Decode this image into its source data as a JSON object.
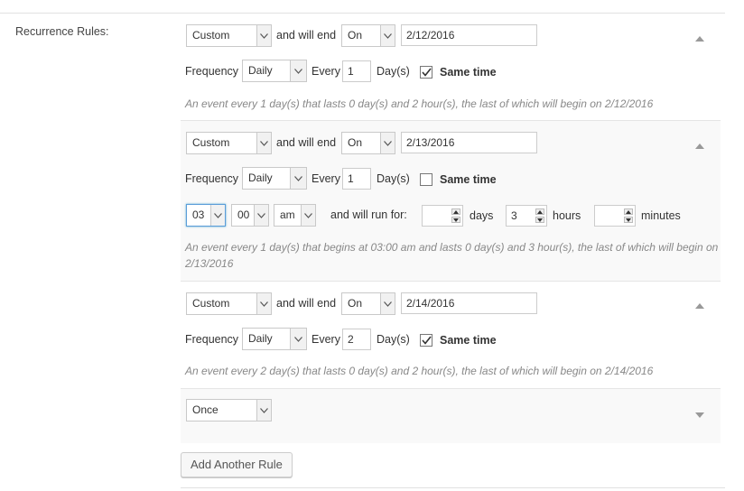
{
  "section": {
    "label": "Recurrence Rules:"
  },
  "common": {
    "and_will_end": "and will end",
    "frequency": "Frequency",
    "every": "Every",
    "same_time": "Same time",
    "and_will_run_for": "and will run for:",
    "days": "days",
    "hours": "hours",
    "minutes": "minutes"
  },
  "rules": [
    {
      "type": "Custom",
      "end_type": "On",
      "end_date": "2/12/2016",
      "frequency": "Daily",
      "interval": "1",
      "interval_unit": "Day(s)",
      "same_time": true,
      "description": "An event every 1 day(s) that lasts 0 day(s) and 2 hour(s), the last of which will begin on 2/12/2016"
    },
    {
      "type": "Custom",
      "end_type": "On",
      "end_date": "2/13/2016",
      "frequency": "Daily",
      "interval": "1",
      "interval_unit": "Day(s)",
      "same_time": false,
      "start_hour": "03",
      "start_minute": "00",
      "start_meridian": "am",
      "duration_days": "",
      "duration_hours": "3",
      "duration_minutes": "",
      "description_line1": "An event every 1 day(s) that begins at 03:00 am and lasts 0 day(s) and 3 hour(s), the last of which will begin on",
      "description_line2": "2/13/2016"
    },
    {
      "type": "Custom",
      "end_type": "On",
      "end_date": "2/14/2016",
      "frequency": "Daily",
      "interval": "2",
      "interval_unit": "Day(s)",
      "same_time": true,
      "description": "An event every 2 day(s) that lasts 0 day(s) and 2 hour(s), the last of which will begin on 2/14/2016"
    },
    {
      "type": "Once"
    }
  ],
  "add_rule_button": "Add Another Rule"
}
